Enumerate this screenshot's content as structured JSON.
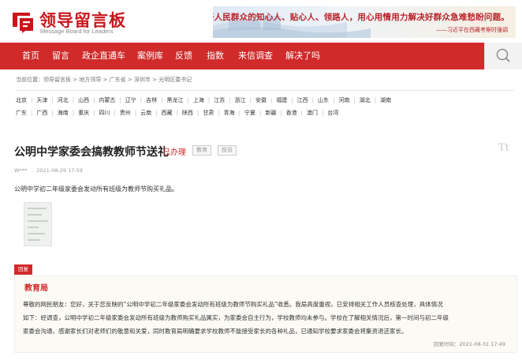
{
  "header": {
    "logo_title": "领导留言板",
    "logo_subtitle": "Message Board for Leaders",
    "banner_quote": "当好人民群众的知心人、贴心人、领路人，用心用情用力解决好群众急难愁盼问题。",
    "banner_source": "——习近平在西藏考察时强调"
  },
  "nav": {
    "items": [
      "首页",
      "留言",
      "政企直通车",
      "案例库",
      "反馈",
      "指数",
      "来信调查",
      "解决了吗"
    ]
  },
  "breadcrumb": "当前位置：领导留言板 > 地方领导 > 广东省 > 深圳市 > 光明区委书记",
  "regions": {
    "row1": [
      "北京",
      "天津",
      "河北",
      "山西",
      "内蒙古",
      "辽宁",
      "吉林",
      "黑龙江",
      "上海",
      "江苏",
      "浙江",
      "安徽",
      "福建",
      "江西",
      "山东",
      "河南",
      "湖北",
      "湖南"
    ],
    "row2": [
      "广东",
      "广西",
      "海南",
      "重庆",
      "四川",
      "贵州",
      "云南",
      "西藏",
      "陕西",
      "甘肃",
      "青海",
      "宁夏",
      "新疆",
      "香港",
      "澳门",
      "台湾"
    ]
  },
  "message": {
    "title": "公明中学家委会搞教教师节送礼",
    "status": "已办理",
    "tag_category": "教育",
    "tag_type": "投诉",
    "font_toggle": "Tt",
    "author": "W***",
    "time": "2021-08-29 17:59",
    "content": "公明中学初二年级家委会发动所有班级为教师节购买礼品。"
  },
  "reply": {
    "tag": "回复",
    "org": "教育局",
    "lines": [
      "尊敬的网民朋友：您好，关于您反映的“公明中学初二年级家委会发动所有班级为教师节购买礼品”收悉。我局高度重视，已安排相关工作人员核查处理，具体情况",
      "如下：经调查，公明中学初二年级家委会发动所有班级为教师购买礼品属实，为家委会自主行为，学校教师均未参与。学校在了解相关情况后，第一时间与初二年级",
      "家委会沟通，感谢家长们对老师们的敬意和关爱，同时教育局明确要求学校教师不能接受家长的各种礼品，已通知学校要求家委会将集资退还家长。"
    ],
    "time": "回复时间：2021-08-31 17:49"
  },
  "colors": {
    "brand_red": "#d12a2a",
    "logo_red": "#c8161d"
  }
}
